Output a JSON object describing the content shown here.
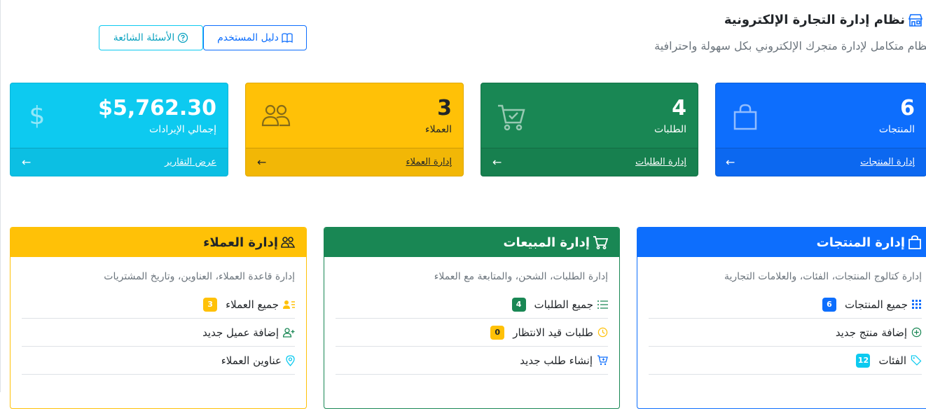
{
  "header": {
    "title": "نظام إدارة التجارة الإلكترونية",
    "subtitle": "نظام متكامل لإدارة متجرك الإلكتروني بكل سهولة واحترافية"
  },
  "buttons": {
    "guide": "دليل المستخدم",
    "faq": "الأسئلة الشائعة"
  },
  "stats": {
    "products": {
      "value": "6",
      "label": "المنتجات",
      "link": "إدارة المنتجات"
    },
    "orders": {
      "value": "4",
      "label": "الطلبات",
      "link": "إدارة الطلبات"
    },
    "customers": {
      "value": "3",
      "label": "العملاء",
      "link": "إدارة العملاء"
    },
    "revenue": {
      "value": "$5,762.30",
      "label": "إجمالي الإيرادات",
      "link": "عرض التقارير"
    }
  },
  "panels": {
    "products": {
      "title": "إدارة المنتجات",
      "desc": "إدارة كتالوج المنتجات، الفئات، والعلامات التجارية",
      "items": [
        {
          "label": "جميع المنتجات",
          "badge": "6"
        },
        {
          "label": "إضافة منتج جديد",
          "badge": ""
        },
        {
          "label": "الفئات",
          "badge": "12"
        }
      ]
    },
    "sales": {
      "title": "إدارة المبيعات",
      "desc": "إدارة الطلبات، الشحن، والمتابعة مع العملاء",
      "items": [
        {
          "label": "جميع الطلبات",
          "badge": "4"
        },
        {
          "label": "طلبات قيد الانتظار",
          "badge": "0"
        },
        {
          "label": "إنشاء طلب جديد",
          "badge": ""
        }
      ]
    },
    "customers": {
      "title": "إدارة العملاء",
      "desc": "إدارة قاعدة العملاء، العناوين، وتاريخ المشتريات",
      "items": [
        {
          "label": "جميع العملاء",
          "badge": "3"
        },
        {
          "label": "إضافة عميل جديد",
          "badge": ""
        },
        {
          "label": "عناوين العملاء",
          "badge": ""
        }
      ]
    }
  },
  "colors": {
    "primary": "#0d6efd",
    "success": "#198754",
    "warning": "#ffc107",
    "info": "#0dcaf0"
  }
}
